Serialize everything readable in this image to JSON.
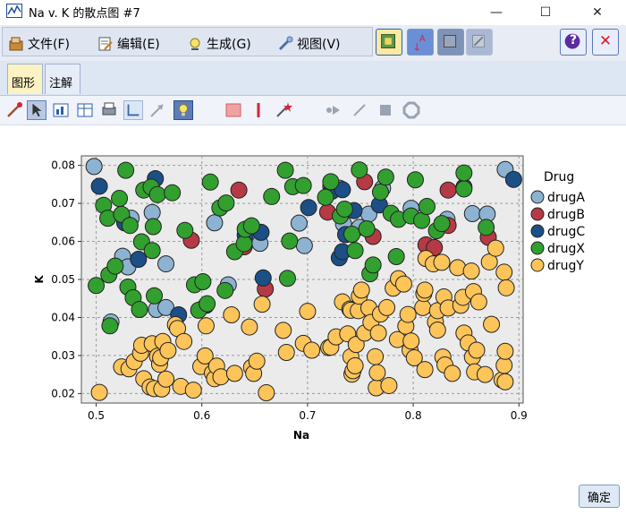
{
  "window": {
    "title": "Na v. K 的散点图 #7",
    "minimize": "—",
    "maximize": "☐",
    "close": "✕"
  },
  "menu": {
    "items": [
      {
        "label": "文件(F)",
        "icon": "file-icon"
      },
      {
        "label": "编辑(E)",
        "icon": "edit-icon"
      },
      {
        "label": "生成(G)",
        "icon": "generate-icon"
      },
      {
        "label": "视图(V)",
        "icon": "view-icon"
      }
    ],
    "help_glyph": "?",
    "close_glyph": "✕"
  },
  "tabs": [
    {
      "label": "图形",
      "active": true
    },
    {
      "label": "注解",
      "active": false
    }
  ],
  "buttons": {
    "ok": "确定"
  },
  "chart_data": {
    "type": "scatter",
    "title": "",
    "xlabel": "Na",
    "ylabel": "K",
    "xlim": [
      0.486,
      0.904
    ],
    "ylim": [
      0.0175,
      0.0825
    ],
    "xticks": [
      0.5,
      0.6,
      0.7,
      0.8,
      0.9
    ],
    "yticks": [
      0.02,
      0.03,
      0.04,
      0.05,
      0.06,
      0.07,
      0.08
    ],
    "xtick_labels": [
      "0.5",
      "0.6",
      "0.7",
      "0.8",
      "0.9"
    ],
    "ytick_labels": [
      "0.02",
      "0.03",
      "0.04",
      "0.05",
      "0.06",
      "0.07",
      "0.08"
    ],
    "grid": true,
    "legend_title": "Drug",
    "legend_position": "right",
    "series": [
      {
        "name": "drugA",
        "color": "#8db3d2",
        "points": [
          [
            0.498,
            0.0797
          ],
          [
            0.533,
            0.0661
          ],
          [
            0.525,
            0.0561
          ],
          [
            0.53,
            0.0533
          ],
          [
            0.557,
            0.0421
          ],
          [
            0.566,
            0.0426
          ],
          [
            0.566,
            0.0541
          ],
          [
            0.553,
            0.0676
          ],
          [
            0.514,
            0.0388
          ],
          [
            0.612,
            0.0649
          ],
          [
            0.625,
            0.0486
          ],
          [
            0.655,
            0.0595
          ],
          [
            0.692,
            0.0648
          ],
          [
            0.697,
            0.0589
          ],
          [
            0.734,
            0.0646
          ],
          [
            0.749,
            0.0637
          ],
          [
            0.758,
            0.0672
          ],
          [
            0.771,
            0.074
          ],
          [
            0.798,
            0.0687
          ],
          [
            0.832,
            0.0658
          ],
          [
            0.856,
            0.0673
          ],
          [
            0.87,
            0.0672
          ],
          [
            0.887,
            0.0789
          ],
          [
            0.73,
            0.074
          ]
        ]
      },
      {
        "name": "drugB",
        "color": "#b53a45",
        "points": [
          [
            0.59,
            0.0603
          ],
          [
            0.635,
            0.0735
          ],
          [
            0.64,
            0.0586
          ],
          [
            0.66,
            0.0475
          ],
          [
            0.719,
            0.0677
          ],
          [
            0.722,
            0.0745
          ],
          [
            0.754,
            0.0757
          ],
          [
            0.762,
            0.0613
          ],
          [
            0.812,
            0.0591
          ],
          [
            0.82,
            0.0584
          ],
          [
            0.833,
            0.0642
          ],
          [
            0.833,
            0.0735
          ],
          [
            0.871,
            0.0611
          ]
        ]
      },
      {
        "name": "drugC",
        "color": "#1c4f86",
        "points": [
          [
            0.503,
            0.0745
          ],
          [
            0.556,
            0.0765
          ],
          [
            0.54,
            0.0553
          ],
          [
            0.527,
            0.0649
          ],
          [
            0.578,
            0.0407
          ],
          [
            0.604,
            0.0432
          ],
          [
            0.641,
            0.0617
          ],
          [
            0.656,
            0.0624
          ],
          [
            0.658,
            0.0504
          ],
          [
            0.701,
            0.0689
          ],
          [
            0.723,
            0.0732
          ],
          [
            0.73,
            0.0557
          ],
          [
            0.733,
            0.0573
          ],
          [
            0.733,
            0.0736
          ],
          [
            0.744,
            0.0681
          ],
          [
            0.768,
            0.0696
          ],
          [
            0.848,
            0.0743
          ],
          [
            0.895,
            0.0763
          ],
          [
            0.736,
            0.0618
          ]
        ]
      },
      {
        "name": "drugX",
        "color": "#32a02f",
        "points": [
          [
            0.5,
            0.0484
          ],
          [
            0.507,
            0.0695
          ],
          [
            0.511,
            0.0661
          ],
          [
            0.512,
            0.0512
          ],
          [
            0.513,
            0.0378
          ],
          [
            0.518,
            0.0535
          ],
          [
            0.522,
            0.0713
          ],
          [
            0.524,
            0.0671
          ],
          [
            0.528,
            0.0787
          ],
          [
            0.53,
            0.048
          ],
          [
            0.532,
            0.0642
          ],
          [
            0.535,
            0.0452
          ],
          [
            0.541,
            0.0421
          ],
          [
            0.543,
            0.0599
          ],
          [
            0.545,
            0.0735
          ],
          [
            0.552,
            0.0743
          ],
          [
            0.553,
            0.0576
          ],
          [
            0.554,
            0.0639
          ],
          [
            0.555,
            0.0457
          ],
          [
            0.558,
            0.0723
          ],
          [
            0.572,
            0.0728
          ],
          [
            0.584,
            0.0629
          ],
          [
            0.593,
            0.0486
          ],
          [
            0.597,
            0.0419
          ],
          [
            0.601,
            0.0494
          ],
          [
            0.605,
            0.0436
          ],
          [
            0.608,
            0.0756
          ],
          [
            0.617,
            0.0688
          ],
          [
            0.622,
            0.0471
          ],
          [
            0.623,
            0.0701
          ],
          [
            0.631,
            0.0573
          ],
          [
            0.64,
            0.0594
          ],
          [
            0.641,
            0.0632
          ],
          [
            0.647,
            0.0641
          ],
          [
            0.666,
            0.0718
          ],
          [
            0.679,
            0.0787
          ],
          [
            0.681,
            0.0503
          ],
          [
            0.683,
            0.0601
          ],
          [
            0.686,
            0.0744
          ],
          [
            0.696,
            0.0747
          ],
          [
            0.717,
            0.0716
          ],
          [
            0.722,
            0.0757
          ],
          [
            0.731,
            0.0667
          ],
          [
            0.735,
            0.0685
          ],
          [
            0.742,
            0.0619
          ],
          [
            0.745,
            0.0576
          ],
          [
            0.749,
            0.0788
          ],
          [
            0.756,
            0.0633
          ],
          [
            0.759,
            0.0515
          ],
          [
            0.762,
            0.0538
          ],
          [
            0.769,
            0.073
          ],
          [
            0.774,
            0.0769
          ],
          [
            0.779,
            0.0674
          ],
          [
            0.784,
            0.056
          ],
          [
            0.786,
            0.0658
          ],
          [
            0.798,
            0.0667
          ],
          [
            0.802,
            0.0762
          ],
          [
            0.808,
            0.0655
          ],
          [
            0.813,
            0.0692
          ],
          [
            0.822,
            0.0628
          ],
          [
            0.827,
            0.0647
          ],
          [
            0.848,
            0.0738
          ],
          [
            0.848,
            0.078
          ],
          [
            0.869,
            0.0637
          ]
        ]
      },
      {
        "name": "drugY",
        "color": "#fdc45a",
        "points": [
          [
            0.503,
            0.0203
          ],
          [
            0.524,
            0.027
          ],
          [
            0.531,
            0.0265
          ],
          [
            0.536,
            0.0284
          ],
          [
            0.542,
            0.0306
          ],
          [
            0.543,
            0.0327
          ],
          [
            0.545,
            0.0239
          ],
          [
            0.551,
            0.0217
          ],
          [
            0.553,
            0.0331
          ],
          [
            0.555,
            0.0213
          ],
          [
            0.558,
            0.0298
          ],
          [
            0.56,
            0.0277
          ],
          [
            0.561,
            0.0294
          ],
          [
            0.562,
            0.0212
          ],
          [
            0.563,
            0.0337
          ],
          [
            0.566,
            0.0238
          ],
          [
            0.568,
            0.0313
          ],
          [
            0.575,
            0.0381
          ],
          [
            0.577,
            0.0371
          ],
          [
            0.58,
            0.0219
          ],
          [
            0.583,
            0.0337
          ],
          [
            0.592,
            0.0209
          ],
          [
            0.599,
            0.0271
          ],
          [
            0.603,
            0.0299
          ],
          [
            0.604,
            0.0378
          ],
          [
            0.61,
            0.0254
          ],
          [
            0.612,
            0.0239
          ],
          [
            0.614,
            0.0272
          ],
          [
            0.618,
            0.0244
          ],
          [
            0.628,
            0.0407
          ],
          [
            0.631,
            0.0253
          ],
          [
            0.645,
            0.0375
          ],
          [
            0.647,
            0.0269
          ],
          [
            0.649,
            0.0253
          ],
          [
            0.652,
            0.0285
          ],
          [
            0.657,
            0.0435
          ],
          [
            0.661,
            0.0202
          ],
          [
            0.677,
            0.0366
          ],
          [
            0.68,
            0.0308
          ],
          [
            0.696,
            0.0332
          ],
          [
            0.7,
            0.0416
          ],
          [
            0.704,
            0.0314
          ],
          [
            0.72,
            0.0321
          ],
          [
            0.722,
            0.0322
          ],
          [
            0.727,
            0.0349
          ],
          [
            0.733,
            0.0441
          ],
          [
            0.738,
            0.0357
          ],
          [
            0.74,
            0.0422
          ],
          [
            0.741,
            0.0297
          ],
          [
            0.741,
            0.0419
          ],
          [
            0.742,
            0.0251
          ],
          [
            0.743,
            0.026
          ],
          [
            0.745,
            0.0273
          ],
          [
            0.746,
            0.0329
          ],
          [
            0.748,
            0.0418
          ],
          [
            0.749,
            0.0456
          ],
          [
            0.751,
            0.0472
          ],
          [
            0.754,
            0.0359
          ],
          [
            0.758,
            0.0425
          ],
          [
            0.76,
            0.0387
          ],
          [
            0.764,
            0.0297
          ],
          [
            0.765,
            0.0215
          ],
          [
            0.766,
            0.0255
          ],
          [
            0.767,
            0.0359
          ],
          [
            0.769,
            0.0409
          ],
          [
            0.775,
            0.0426
          ],
          [
            0.777,
            0.0221
          ],
          [
            0.781,
            0.0477
          ],
          [
            0.785,
            0.0342
          ],
          [
            0.786,
            0.0502
          ],
          [
            0.791,
            0.0488
          ],
          [
            0.793,
            0.0377
          ],
          [
            0.795,
            0.0408
          ],
          [
            0.797,
            0.0314
          ],
          [
            0.798,
            0.0338
          ],
          [
            0.801,
            0.0294
          ],
          [
            0.809,
            0.0426
          ],
          [
            0.81,
            0.0463
          ],
          [
            0.811,
            0.0263
          ],
          [
            0.811,
            0.0472
          ],
          [
            0.812,
            0.0555
          ],
          [
            0.819,
            0.0541
          ],
          [
            0.821,
            0.0388
          ],
          [
            0.823,
            0.0418
          ],
          [
            0.823,
            0.0367
          ],
          [
            0.827,
            0.0545
          ],
          [
            0.828,
            0.0296
          ],
          [
            0.829,
            0.0454
          ],
          [
            0.83,
            0.0275
          ],
          [
            0.833,
            0.0425
          ],
          [
            0.837,
            0.0253
          ],
          [
            0.842,
            0.0531
          ],
          [
            0.845,
            0.0432
          ],
          [
            0.847,
            0.0453
          ],
          [
            0.848,
            0.0359
          ],
          [
            0.852,
            0.0333
          ],
          [
            0.855,
            0.0522
          ],
          [
            0.856,
            0.0296
          ],
          [
            0.857,
            0.0468
          ],
          [
            0.858,
            0.0257
          ],
          [
            0.86,
            0.0314
          ],
          [
            0.862,
            0.0441
          ],
          [
            0.868,
            0.025
          ],
          [
            0.872,
            0.0546
          ],
          [
            0.874,
            0.0382
          ],
          [
            0.878,
            0.0582
          ],
          [
            0.884,
            0.0236
          ],
          [
            0.886,
            0.0519
          ],
          [
            0.886,
            0.0274
          ],
          [
            0.887,
            0.0231
          ],
          [
            0.887,
            0.0311
          ],
          [
            0.888,
            0.0478
          ]
        ]
      }
    ]
  }
}
